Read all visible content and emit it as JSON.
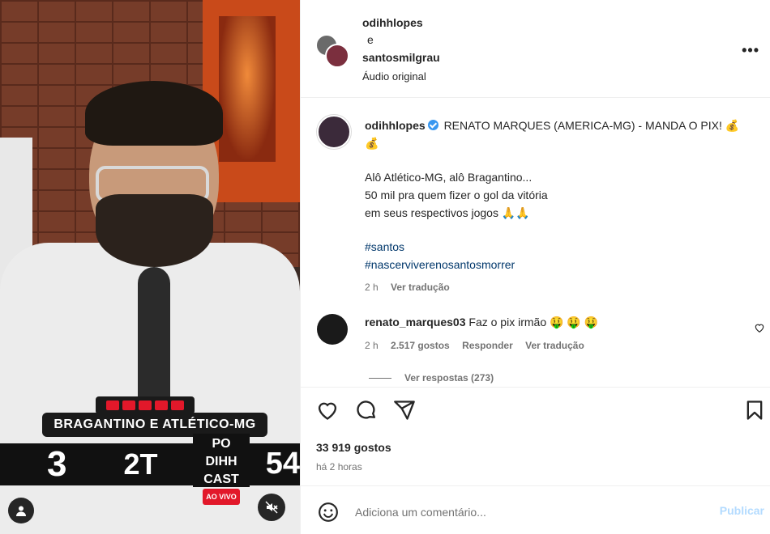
{
  "header": {
    "user1": "odihhlopes",
    "conj": "e",
    "user2": "santosmilgrau",
    "audio": "Áudio original",
    "more_label": "•••"
  },
  "caption": {
    "username": "odihhlopes",
    "title": "RENATO MARQUES (AMERICA-MG) - MANDA O PIX! 💰 💰",
    "line1": "Alô Atlético-MG, alô Bragantino...",
    "line2": "50 mil pra quem fizer o gol da vitória",
    "line3": "em seus respectivos jogos 🙏🙏",
    "hashtag1": "#santos",
    "hashtag2": "#nascerviverenosantosmorrer",
    "time": "2 h",
    "translate": "Ver tradução"
  },
  "comment": {
    "username": "renato_marques03",
    "text": "Faz o pix irmão 🤑 🤑 🤑",
    "time": "2 h",
    "likes": "2.517 gostos",
    "reply": "Responder",
    "translate": "Ver tradução",
    "view_replies": "Ver respostas (273)"
  },
  "post": {
    "likes": "33 919 gostos",
    "time": "há 2 horas"
  },
  "add_comment": {
    "placeholder": "Adiciona um comentário...",
    "publish": "Publicar"
  },
  "video": {
    "scoreboard_title": "BRAGANTINO E ATLÉTICO-MG",
    "score": "3",
    "half": "2T",
    "minute": "54",
    "logo_line1": "PO",
    "logo_line2": "DIHH",
    "logo_line3": "CAST",
    "logo_live": "AO VIVO"
  },
  "colors": {
    "link": "#00376b",
    "verified": "#3897f0",
    "publish_disabled": "#b3dbff",
    "secondary_text": "#737373"
  }
}
